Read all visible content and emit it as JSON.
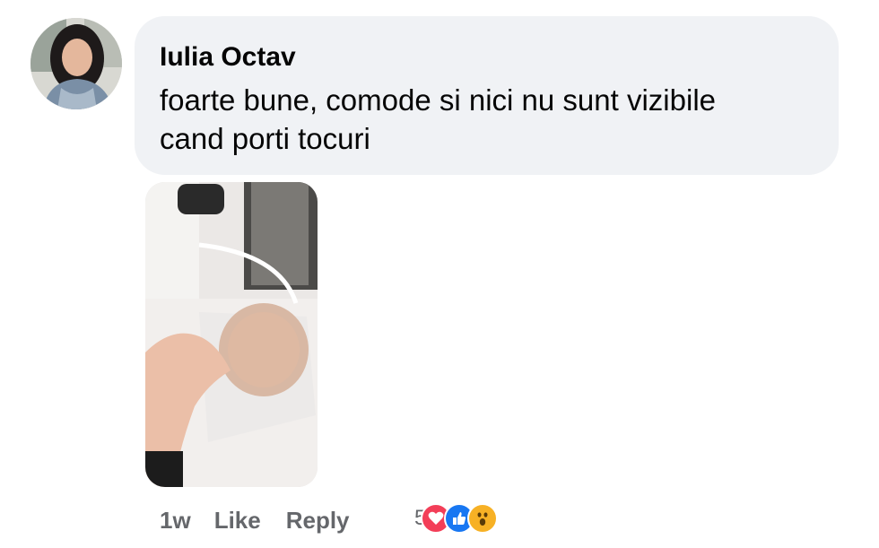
{
  "comment": {
    "author": "Iulia Octav",
    "text_line1": "foarte bune, comode si nici nu sunt vizibile",
    "text_line2": "cand porti tocuri"
  },
  "actions": {
    "time": "1w",
    "like_label": "Like",
    "reply_label": "Reply"
  },
  "reactions": {
    "count": "5",
    "icons": [
      "love-icon",
      "like-icon",
      "wow-icon"
    ],
    "colors": {
      "love": "#f33e58",
      "like": "#1877f2",
      "wow": "#f7b125"
    }
  },
  "colors": {
    "bubble": "#f0f2f5",
    "text": "#050505",
    "meta": "#65676b"
  }
}
